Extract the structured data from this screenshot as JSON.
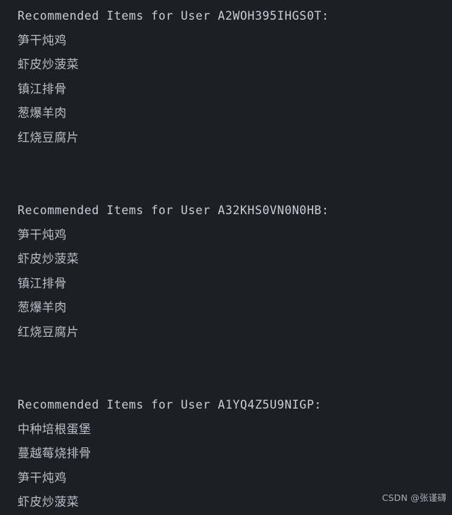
{
  "terminal": {
    "background_color": "#1e1f25",
    "header_color": "#c9ced8",
    "item_color": "#b9bec8",
    "blocks": [
      {
        "header": "Recommended Items for User A2WOH395IHGS0T:",
        "items": [
          "笋干炖鸡",
          "虾皮炒菠菜",
          "镇江排骨",
          "葱爆羊肉",
          "红烧豆腐片"
        ]
      },
      {
        "header": "Recommended Items for User A32KHS0VN0N0HB:",
        "items": [
          "笋干炖鸡",
          "虾皮炒菠菜",
          "镇江排骨",
          "葱爆羊肉",
          "红烧豆腐片"
        ]
      },
      {
        "header": "Recommended Items for User A1YQ4Z5U9NIGP:",
        "items": [
          "中种培根蛋堡",
          "蔓越莓烧排骨",
          "笋干炖鸡",
          "虾皮炒菠菜"
        ]
      }
    ]
  },
  "watermark": {
    "text": "CSDN @张谨礴"
  }
}
